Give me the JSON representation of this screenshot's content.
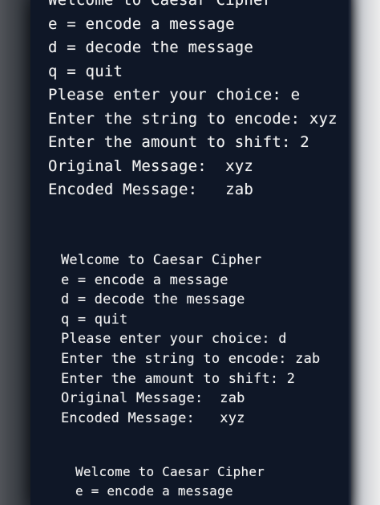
{
  "blocks": [
    {
      "lines": [
        "Welcome to Caesar Cipher",
        "e = encode a message",
        "d = decode the message",
        "q = quit",
        "Please enter your choice: e",
        "Enter the string to encode: xyz",
        "Enter the amount to shift: 2",
        "Original Message:  xyz",
        "Encoded Message:   zab"
      ]
    },
    {
      "lines": [
        "Welcome to Caesar Cipher",
        "e = encode a message",
        "d = decode the message",
        "q = quit",
        "Please enter your choice: d",
        "Enter the string to encode: zab",
        "Enter the amount to shift: 2",
        "Original Message:  zab",
        "Encoded Message:   xyz"
      ]
    },
    {
      "lines": [
        "Welcome to Caesar Cipher",
        "e = encode a message"
      ]
    }
  ]
}
